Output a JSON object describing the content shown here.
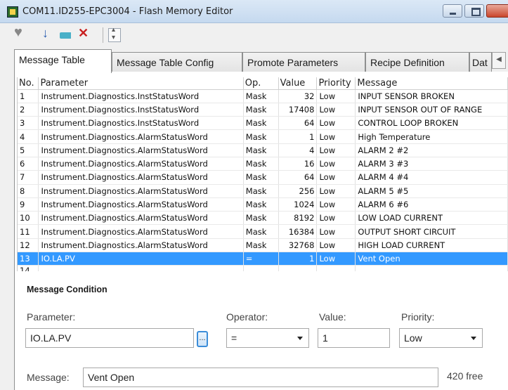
{
  "window": {
    "title": "COM11.ID255-EPC3004 - Flash Memory Editor"
  },
  "toolbar": {
    "icons": [
      "heart-icon",
      "download-arrow-icon",
      "tag-icon",
      "delete-x-icon",
      "spin-icon"
    ]
  },
  "tabs": [
    {
      "label": "Message Table",
      "active": true
    },
    {
      "label": "Message Table Config",
      "active": false
    },
    {
      "label": "Promote Parameters",
      "active": false
    },
    {
      "label": "Recipe Definition",
      "active": false
    },
    {
      "label": "Dat",
      "active": false
    }
  ],
  "table": {
    "columns": [
      "No.",
      "Parameter",
      "Op.",
      "Value",
      "Priority",
      "Message"
    ],
    "rows": [
      {
        "no": "1",
        "parameter": "Instrument.Diagnostics.InstStatusWord",
        "op": "Mask",
        "value": "32",
        "priority": "Low",
        "message": "INPUT SENSOR BROKEN"
      },
      {
        "no": "2",
        "parameter": "Instrument.Diagnostics.InstStatusWord",
        "op": "Mask",
        "value": "17408",
        "priority": "Low",
        "message": "INPUT SENSOR OUT OF RANGE"
      },
      {
        "no": "3",
        "parameter": "Instrument.Diagnostics.InstStatusWord",
        "op": "Mask",
        "value": "64",
        "priority": "Low",
        "message": "CONTROL LOOP BROKEN"
      },
      {
        "no": "4",
        "parameter": "Instrument.Diagnostics.AlarmStatusWord",
        "op": "Mask",
        "value": "1",
        "priority": "Low",
        "message": "High Temperature"
      },
      {
        "no": "5",
        "parameter": "Instrument.Diagnostics.AlarmStatusWord",
        "op": "Mask",
        "value": "4",
        "priority": "Low",
        "message": "ALARM 2 #2"
      },
      {
        "no": "6",
        "parameter": "Instrument.Diagnostics.AlarmStatusWord",
        "op": "Mask",
        "value": "16",
        "priority": "Low",
        "message": "ALARM 3 #3"
      },
      {
        "no": "7",
        "parameter": "Instrument.Diagnostics.AlarmStatusWord",
        "op": "Mask",
        "value": "64",
        "priority": "Low",
        "message": "ALARM 4 #4"
      },
      {
        "no": "8",
        "parameter": "Instrument.Diagnostics.AlarmStatusWord",
        "op": "Mask",
        "value": "256",
        "priority": "Low",
        "message": "ALARM 5 #5"
      },
      {
        "no": "9",
        "parameter": "Instrument.Diagnostics.AlarmStatusWord",
        "op": "Mask",
        "value": "1024",
        "priority": "Low",
        "message": "ALARM 6 #6"
      },
      {
        "no": "10",
        "parameter": "Instrument.Diagnostics.AlarmStatusWord",
        "op": "Mask",
        "value": "8192",
        "priority": "Low",
        "message": "LOW LOAD CURRENT"
      },
      {
        "no": "11",
        "parameter": "Instrument.Diagnostics.AlarmStatusWord",
        "op": "Mask",
        "value": "16384",
        "priority": "Low",
        "message": "OUTPUT SHORT CIRCUIT"
      },
      {
        "no": "12",
        "parameter": "Instrument.Diagnostics.AlarmStatusWord",
        "op": "Mask",
        "value": "32768",
        "priority": "Low",
        "message": "HIGH LOAD CURRENT"
      },
      {
        "no": "13",
        "parameter": "IO.LA.PV",
        "op": "=",
        "value": "1",
        "priority": "Low",
        "message": "Vent Open",
        "selected": true
      },
      {
        "no": "14",
        "parameter": "",
        "op": "",
        "value": "",
        "priority": "",
        "message": "",
        "partial": true
      }
    ]
  },
  "condition": {
    "title": "Message Condition",
    "parameter_label": "Parameter:",
    "parameter_value": "IO.LA.PV",
    "browse_label": "...",
    "operator_label": "Operator:",
    "operator_value": "=",
    "value_label": "Value:",
    "value_value": "1",
    "priority_label": "Priority:",
    "priority_value": "Low",
    "message_label": "Message:",
    "message_value": "Vent Open",
    "free_text": "420 free"
  }
}
